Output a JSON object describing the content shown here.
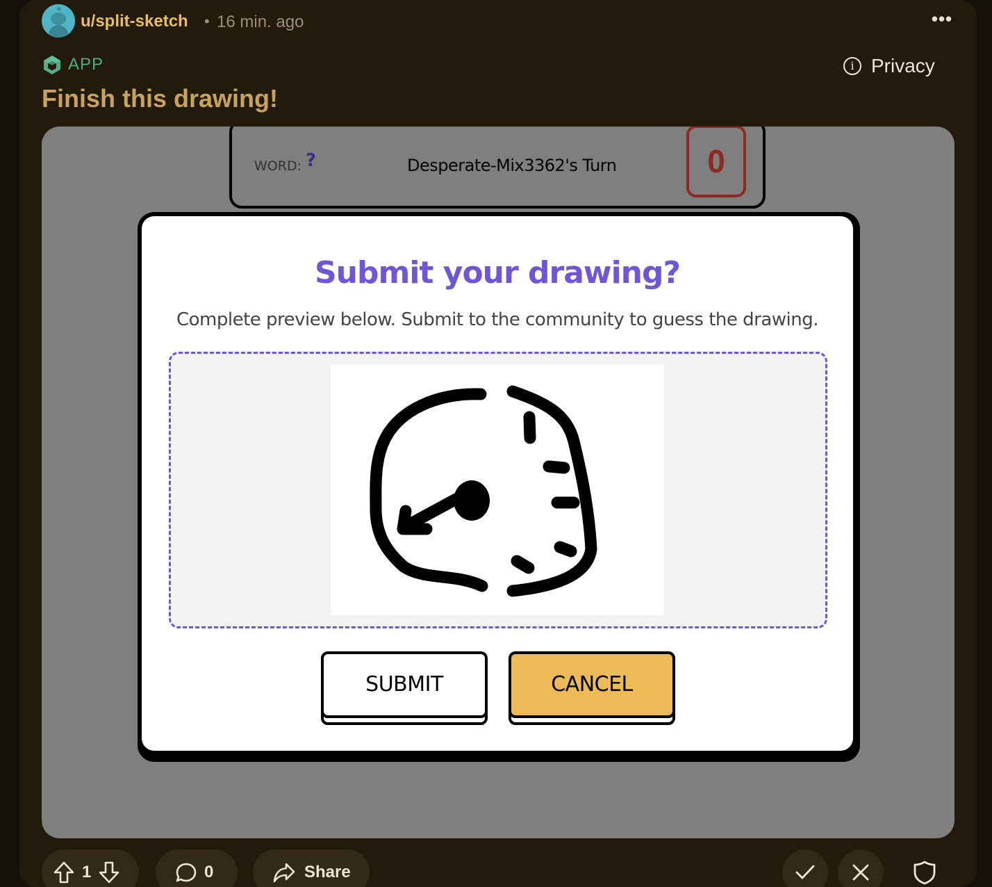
{
  "post": {
    "author": "u/split-sketch",
    "separator": "•",
    "time": "16 min. ago",
    "more_label": "•••",
    "app_label": "APP",
    "privacy_label": "Privacy",
    "title": "Finish this drawing!"
  },
  "game": {
    "word_label": "WORD:",
    "word_value": "?",
    "turn_text": "Desperate-Mix3362's Turn",
    "timer": "0"
  },
  "modal": {
    "title": "Submit your drawing?",
    "description": "Complete preview below. Submit to the community to guess the drawing.",
    "submit_label": "SUBMIT",
    "cancel_label": "CANCEL"
  },
  "actions": {
    "score": "1",
    "comments": "0",
    "share_label": "Share"
  },
  "colors": {
    "accent": "#6e56d6",
    "cancel": "#ecbb57",
    "author": "#e9bd64",
    "app": "#4fae88"
  },
  "icons": [
    "avatar",
    "cube-icon",
    "info-icon",
    "upvote-icon",
    "downvote-icon",
    "comment-icon",
    "share-icon",
    "check-icon",
    "close-icon",
    "shield-icon"
  ]
}
